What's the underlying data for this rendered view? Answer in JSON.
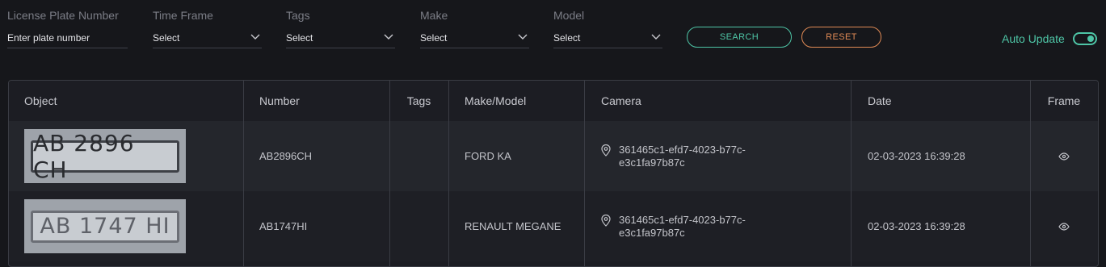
{
  "filters": {
    "plate": {
      "label": "License Plate Number",
      "placeholder": "Enter plate number"
    },
    "time_frame": {
      "label": "Time Frame",
      "value": "Select"
    },
    "tags": {
      "label": "Tags",
      "value": "Select"
    },
    "make": {
      "label": "Make",
      "value": "Select"
    },
    "model": {
      "label": "Model",
      "value": "Select"
    },
    "search_label": "SEARCH",
    "reset_label": "RESET",
    "auto_update_label": "Auto Update",
    "auto_update_on": true
  },
  "table": {
    "columns": [
      "Object",
      "Number",
      "Tags",
      "Make/Model",
      "Camera",
      "Date",
      "Frame"
    ],
    "rows": [
      {
        "plate_image_text": "AB 2896 CH",
        "number": "AB2896CH",
        "tags": "",
        "make_model": "FORD KA",
        "camera": "361465c1-efd7-4023-b77c-e3c1fa97b87c",
        "date": "02-03-2023 16:39:28"
      },
      {
        "plate_image_text": "AB 1747 HI",
        "number": "AB1747HI",
        "tags": "",
        "make_model": "RENAULT MEGANE",
        "camera": "361465c1-efd7-4023-b77c-e3c1fa97b87c",
        "date": "02-03-2023 16:39:28"
      }
    ]
  },
  "colors": {
    "accent": "#4ec5a6",
    "reset": "#e08a55",
    "background": "#16171b"
  },
  "icons": {
    "dropdown": "chevron-down-icon",
    "camera": "location-pin-icon",
    "frame": "eye-icon"
  }
}
